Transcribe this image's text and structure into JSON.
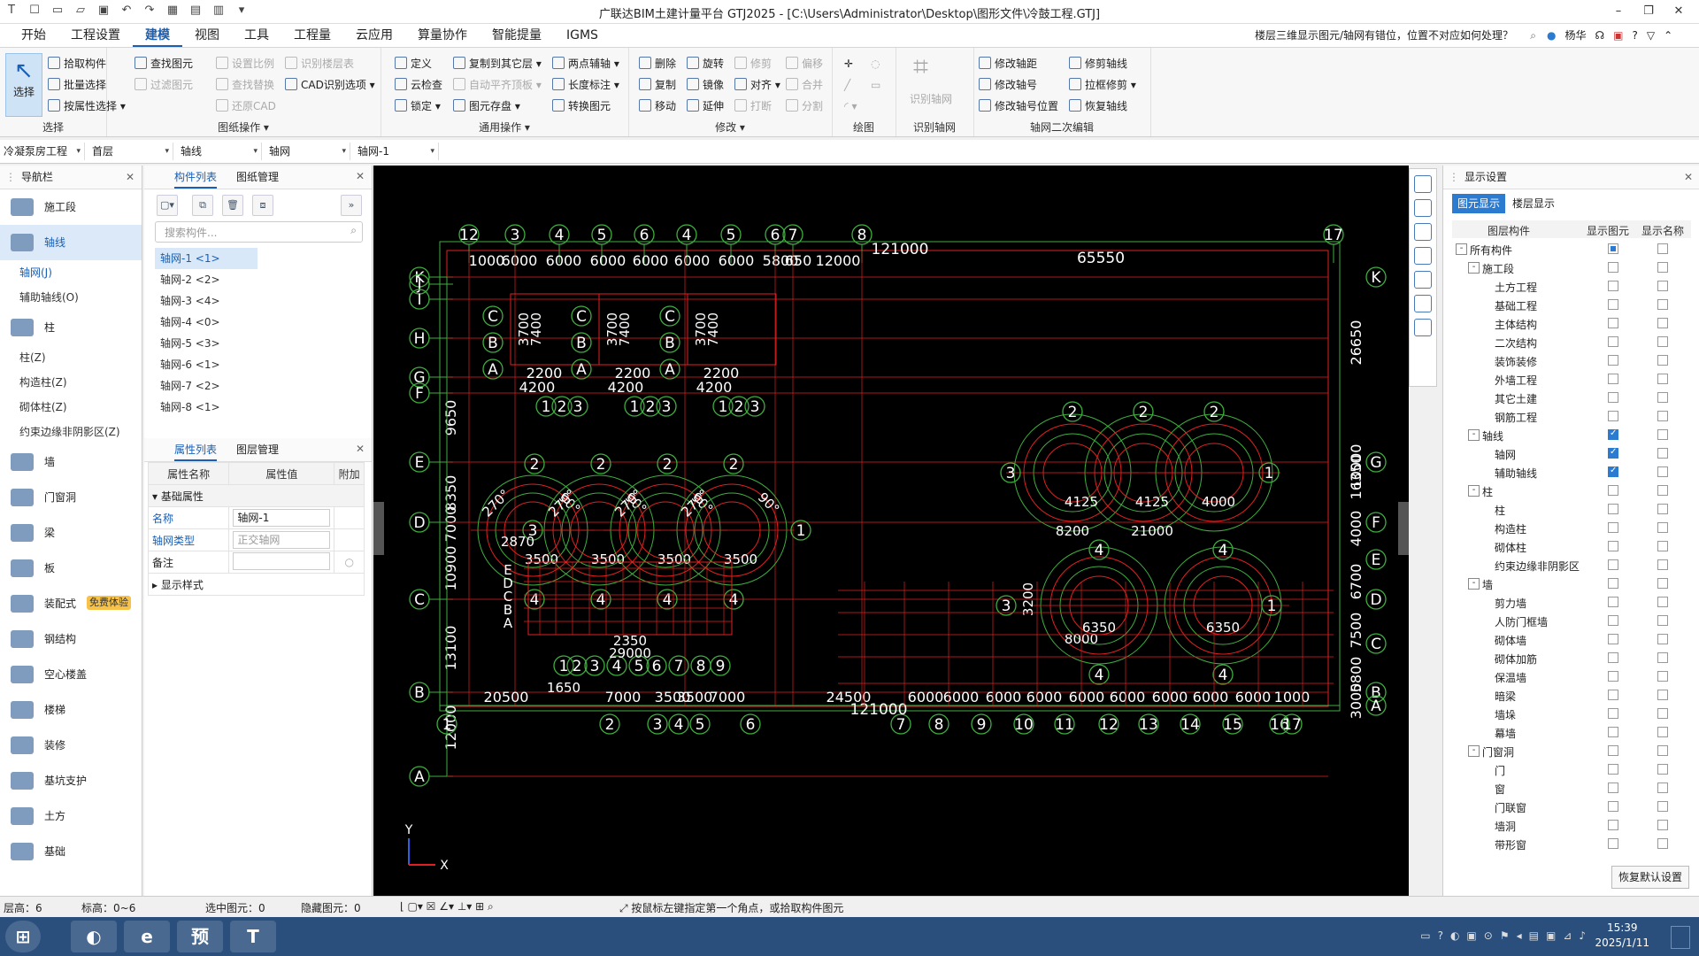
{
  "window": {
    "title": "广联达BIM土建计量平台 GTJ2025 - [C:\\Users\\Administrator\\Desktop\\图形文件\\冷鼓工程.GTJ]"
  },
  "menu": {
    "items": [
      "开始",
      "工程设置",
      "建模",
      "视图",
      "工具",
      "工程量",
      "云应用",
      "算量协作",
      "智能提量",
      "IGMS"
    ],
    "active": "建模"
  },
  "help": {
    "question": "楼层三维显示图元/轴网有错位，位置不对应如何处理？",
    "user": "杨华"
  },
  "ribbon": {
    "select": {
      "label": "选择",
      "group": "选择",
      "items": [
        "拾取构件",
        "批量选择",
        "按属性选择"
      ]
    },
    "drawing": {
      "group": "图纸操作",
      "items": [
        "查找图元",
        "过滤图元",
        "设置比例",
        "查找替换",
        "还原CAD",
        "识别楼层表",
        "CAD识别选项"
      ]
    },
    "common": {
      "group": "通用操作",
      "items": [
        "定义",
        "云检查",
        "锁定",
        "复制到其它层",
        "自动平齐顶板",
        "图元存盘",
        "两点辅轴",
        "长度标注",
        "转换图元"
      ]
    },
    "modify": {
      "group": "修改",
      "items": [
        "删除",
        "复制",
        "移动",
        "旋转",
        "镜像",
        "延伸",
        "修剪",
        "对齐",
        "打断",
        "偏移",
        "合并",
        "分割"
      ]
    },
    "draw": {
      "group": "绘图"
    },
    "recog": {
      "group": "识别轴网",
      "label": "识别轴网"
    },
    "axis2": {
      "group": "轴网二次编辑",
      "items": [
        "修改轴距",
        "修改轴号",
        "修改轴号位置",
        "修剪轴线",
        "拉框修剪",
        "恢复轴线"
      ]
    }
  },
  "selectors": [
    "冷凝泵房工程",
    "首层",
    "轴线",
    "轴网",
    "轴网-1"
  ],
  "nav": {
    "title": "导航栏",
    "items": [
      {
        "label": "施工段"
      },
      {
        "label": "轴线",
        "active": true,
        "subs": [
          "轴网(J)",
          "辅助轴线(O)"
        ]
      },
      {
        "label": "柱",
        "subs": [
          "柱(Z)",
          "构造柱(Z)",
          "砌体柱(Z)",
          "约束边缘非阴影区(Z)"
        ]
      },
      {
        "label": "墙"
      },
      {
        "label": "门窗洞"
      },
      {
        "label": "梁"
      },
      {
        "label": "板"
      },
      {
        "label": "装配式",
        "badge": "免费体验"
      },
      {
        "label": "钢结构"
      },
      {
        "label": "空心楼盖"
      },
      {
        "label": "楼梯"
      },
      {
        "label": "装修"
      },
      {
        "label": "基坑支护"
      },
      {
        "label": "土方"
      },
      {
        "label": "基础"
      }
    ]
  },
  "components": {
    "tabs": [
      "构件列表",
      "图纸管理"
    ],
    "search_placeholder": "搜索构件...",
    "list": [
      "轴网-1 <1>",
      "轴网-2 <2>",
      "轴网-3 <4>",
      "轴网-4 <0>",
      "轴网-5 <3>",
      "轴网-6 <1>",
      "轴网-7 <2>",
      "轴网-8 <1>"
    ]
  },
  "properties": {
    "tabs": [
      "属性列表",
      "图层管理"
    ],
    "headers": [
      "属性名称",
      "属性值",
      "附加"
    ],
    "section": "基础属性",
    "rows": [
      {
        "name": "名称",
        "value": "轴网-1"
      },
      {
        "name": "轴网类型",
        "value": "正交轴网"
      },
      {
        "name": "备注",
        "value": ""
      }
    ],
    "section2": "显示样式"
  },
  "display": {
    "title": "显示设置",
    "tabs": [
      "图元显示",
      "楼层显示"
    ],
    "headers": [
      "图层构件",
      "显示图元",
      "显示名称"
    ],
    "rows": [
      {
        "label": "所有构件",
        "lvl": 0,
        "pm": "-",
        "show": "mixed",
        "name": false
      },
      {
        "label": "施工段",
        "lvl": 1,
        "pm": "-",
        "show": false,
        "name": false
      },
      {
        "label": "土方工程",
        "lvl": 2,
        "show": false,
        "name": false
      },
      {
        "label": "基础工程",
        "lvl": 2,
        "show": false,
        "name": false
      },
      {
        "label": "主体结构",
        "lvl": 2,
        "show": false,
        "name": false
      },
      {
        "label": "二次结构",
        "lvl": 2,
        "show": false,
        "name": false
      },
      {
        "label": "装饰装修",
        "lvl": 2,
        "show": false,
        "name": false
      },
      {
        "label": "外墙工程",
        "lvl": 2,
        "show": false,
        "name": false
      },
      {
        "label": "其它土建",
        "lvl": 2,
        "show": false,
        "name": false
      },
      {
        "label": "钢筋工程",
        "lvl": 2,
        "show": false,
        "name": false
      },
      {
        "label": "轴线",
        "lvl": 1,
        "pm": "-",
        "show": true,
        "name": false
      },
      {
        "label": "轴网",
        "lvl": 2,
        "show": true,
        "name": false
      },
      {
        "label": "辅助轴线",
        "lvl": 2,
        "show": true,
        "name": false
      },
      {
        "label": "柱",
        "lvl": 1,
        "pm": "-",
        "show": false,
        "name": false
      },
      {
        "label": "柱",
        "lvl": 2,
        "show": false,
        "name": false
      },
      {
        "label": "构造柱",
        "lvl": 2,
        "show": false,
        "name": false
      },
      {
        "label": "砌体柱",
        "lvl": 2,
        "show": false,
        "name": false
      },
      {
        "label": "约束边缘非阴影区",
        "lvl": 2,
        "show": false,
        "name": false
      },
      {
        "label": "墙",
        "lvl": 1,
        "pm": "-",
        "show": false,
        "name": false
      },
      {
        "label": "剪力墙",
        "lvl": 2,
        "show": false,
        "name": false
      },
      {
        "label": "人防门框墙",
        "lvl": 2,
        "show": false,
        "name": false
      },
      {
        "label": "砌体墙",
        "lvl": 2,
        "show": false,
        "name": false
      },
      {
        "label": "砌体加筋",
        "lvl": 2,
        "show": false,
        "name": false
      },
      {
        "label": "保温墙",
        "lvl": 2,
        "show": false,
        "name": false
      },
      {
        "label": "暗梁",
        "lvl": 2,
        "show": false,
        "name": false
      },
      {
        "label": "墙垛",
        "lvl": 2,
        "show": false,
        "name": false
      },
      {
        "label": "幕墙",
        "lvl": 2,
        "show": false,
        "name": false
      },
      {
        "label": "门窗洞",
        "lvl": 1,
        "pm": "-",
        "show": false,
        "name": false
      },
      {
        "label": "门",
        "lvl": 2,
        "show": false,
        "name": false
      },
      {
        "label": "窗",
        "lvl": 2,
        "show": false,
        "name": false
      },
      {
        "label": "门联窗",
        "lvl": 2,
        "show": false,
        "name": false
      },
      {
        "label": "墙洞",
        "lvl": 2,
        "show": false,
        "name": false
      },
      {
        "label": "带形窗",
        "lvl": 2,
        "show": false,
        "name": false
      }
    ],
    "reset": "恢复默认设置"
  },
  "cad": {
    "top_axes": [
      "12",
      "3",
      "4",
      "5",
      "6",
      "4",
      "5",
      "6",
      "7",
      "8",
      "17"
    ],
    "top_dims": [
      "1000",
      "6000",
      "6000",
      "6000",
      "6000",
      "6000",
      "6000",
      "5800",
      "650",
      "12000"
    ],
    "top_total": "121000",
    "top_right": "65550",
    "left_axes": [
      "K",
      "J",
      "I",
      "H",
      "G",
      "F",
      "E",
      "D",
      "C",
      "B",
      "A"
    ],
    "left_dims": [
      "9650",
      "8350",
      "10900",
      "13100",
      "12000",
      "7000"
    ],
    "bottom_axes": [
      "1",
      "2",
      "3",
      "4",
      "5",
      "6",
      "7",
      "8",
      "9",
      "10",
      "11",
      "12",
      "13",
      "14",
      "15",
      "16",
      "17"
    ],
    "bottom_dims": [
      "20500",
      "7000",
      "3500",
      "3500",
      "7000",
      "24500"
    ],
    "bottom_right_dims": [
      "6000",
      "6000",
      "6000",
      "6000",
      "6000",
      "6000",
      "6000",
      "6000",
      "6000",
      "1000"
    ],
    "bottom_total": "121000",
    "right_axes": [
      "K",
      "G",
      "F",
      "E",
      "D",
      "C",
      "B",
      "A"
    ],
    "right_dims": [
      "26650",
      "16350",
      "4000",
      "6700",
      "7500",
      "5800",
      "3000"
    ],
    "right_dim_extra": "10000",
    "mid_dims": [
      "2870",
      "3500",
      "3500",
      "3500",
      "4125",
      "4125",
      "4000",
      "3200",
      "8200",
      "21000",
      "6350",
      "6350",
      "8000",
      "1650",
      "2350",
      "29000",
      "2200",
      "4200",
      "3700",
      "7400"
    ],
    "angles": [
      "270°",
      "90°"
    ],
    "mid_letters": [
      "C",
      "B",
      "A"
    ],
    "mid_axes": [
      "1",
      "2",
      "3",
      "4"
    ],
    "lower_left_letters": [
      "E",
      "D",
      "C",
      "B",
      "A"
    ],
    "coord_y": "Y",
    "coord_x": "X"
  },
  "status": {
    "floor_height": "层高：6",
    "elevation": "标高：0~6",
    "selected": "选中图元：0",
    "hidden": "隐藏图元：0",
    "hint": "按鼠标左键指定第一个角点，或拾取构件图元"
  },
  "taskbar": {
    "time": "15:39",
    "date": "2025/1/11",
    "apps": [
      "",
      "",
      "预",
      ""
    ]
  }
}
